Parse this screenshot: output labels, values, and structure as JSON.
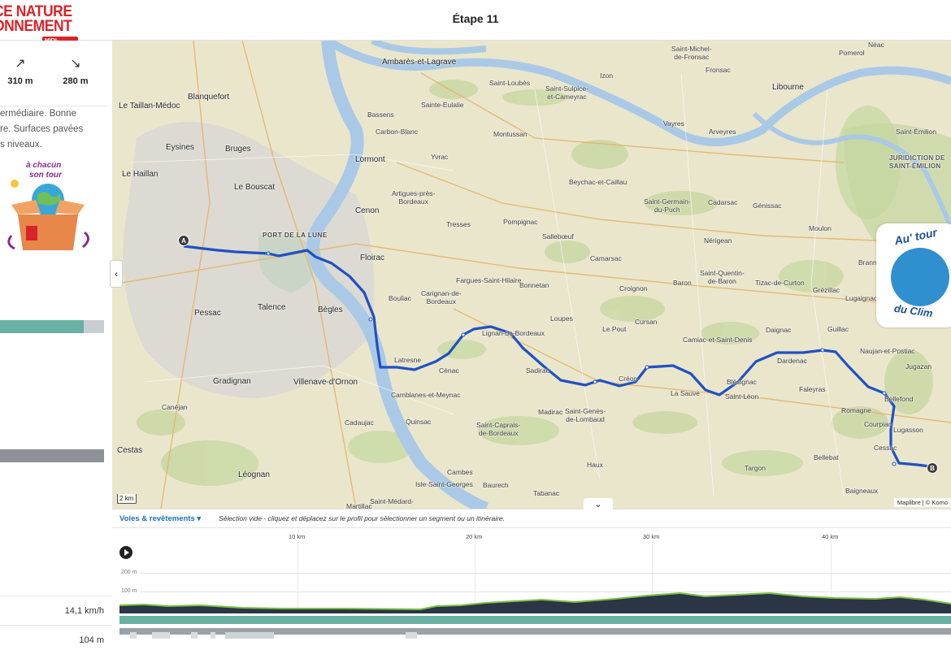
{
  "header": {
    "logo_line1": "CE NATURE",
    "logo_line2": "ONNEMENT",
    "logo_line3": "MIDI-PYRÉNÉES",
    "title": "Étape 11"
  },
  "sidebar": {
    "ascent": "310 m",
    "descent": "280 m",
    "description": [
      "ermédiaire. Bonne",
      "re. Surfaces pavées",
      "s niveaux."
    ],
    "badge_text_1": "à chacun",
    "badge_text_2": "son tour",
    "stat_speed": "14,1 km/h",
    "stat_other": "104 m"
  },
  "map": {
    "start_label": "A",
    "end_label": "B",
    "scale": "2 km",
    "attribution": "Maplibre | © Komo",
    "route_color": "#1f51c4",
    "water_color": "#a9c9e6",
    "climat_line1": "Au' tour",
    "climat_line2": "du Clim",
    "places": [
      {
        "name": "Saint-Michel-",
        "name2": "de-Fronsac"
      },
      {
        "name": "Ambarès-et-Lagrave"
      },
      {
        "name": "Saint-Loubès"
      },
      {
        "name": "Saint-Sulpice-",
        "name2": "et-Cameyrac"
      },
      {
        "name": "Izon"
      },
      {
        "name": "Fronsac"
      },
      {
        "name": "Libourne"
      },
      {
        "name": "Néac"
      },
      {
        "name": "Pomerol"
      },
      {
        "name": "Le Taillan-Médoc"
      },
      {
        "name": "Blanquefort"
      },
      {
        "name": "Sainte-Eulalie"
      },
      {
        "name": "Bassens"
      },
      {
        "name": "Carbon-Blanc"
      },
      {
        "name": "Vayres"
      },
      {
        "name": "Arveyres"
      },
      {
        "name": "Saint-Émilion"
      },
      {
        "name": "Eysines"
      },
      {
        "name": "Bruges"
      },
      {
        "name": "Lormont"
      },
      {
        "name": "Yvrac"
      },
      {
        "name": "Montussan"
      },
      {
        "name": "Le Haillan"
      },
      {
        "name": "Beychac-et-Caillau"
      },
      {
        "name": "Le Bouscat"
      },
      {
        "name": "Artigues-près-",
        "name2": "Bordeaux"
      },
      {
        "name": "Saint-Germain-",
        "name2": "du-Puch"
      },
      {
        "name": "Cadarsac"
      },
      {
        "name": "Génissac"
      },
      {
        "name": "Cenon"
      },
      {
        "name": "Tresses"
      },
      {
        "name": "Pompignac"
      },
      {
        "name": "Moulon"
      },
      {
        "name": "Sallebœuf"
      },
      {
        "name": "Nérigean"
      },
      {
        "name": "Camarsac"
      },
      {
        "name": "Floirac"
      },
      {
        "name": "Saint-Quentin-",
        "name2": "de-Baron"
      },
      {
        "name": "Fargues-Saint-Hilaire"
      },
      {
        "name": "Bonnetan"
      },
      {
        "name": "Baron"
      },
      {
        "name": "Tizac-de-Curton"
      },
      {
        "name": "Carignan-de-",
        "name2": "Bordeaux"
      },
      {
        "name": "Croignon"
      },
      {
        "name": "Grézillac"
      },
      {
        "name": "Pessac"
      },
      {
        "name": "Talence"
      },
      {
        "name": "Bègles"
      },
      {
        "name": "Bouliac"
      },
      {
        "name": "Lugaignac"
      },
      {
        "name": "Loupes"
      },
      {
        "name": "Cursan"
      },
      {
        "name": "Le Pout"
      },
      {
        "name": "Daignac"
      },
      {
        "name": "Lignan-de-Bordeaux"
      },
      {
        "name": "Guillac"
      },
      {
        "name": "Camiac-et-Saint-Denis"
      },
      {
        "name": "Latresne"
      },
      {
        "name": "Dardenac"
      },
      {
        "name": "Naujan-et-Postiac"
      },
      {
        "name": "Cénac"
      },
      {
        "name": "Sadirac"
      },
      {
        "name": "Créon"
      },
      {
        "name": "Blésignac"
      },
      {
        "name": "Jugazan"
      },
      {
        "name": "Gradignan"
      },
      {
        "name": "Villenave-d'Ornon"
      },
      {
        "name": "Faleyras"
      },
      {
        "name": "La Sauve"
      },
      {
        "name": "Saint-Léon"
      },
      {
        "name": "Camblanes-et-Meynac"
      },
      {
        "name": "Bellefond"
      },
      {
        "name": "Romagne"
      },
      {
        "name": "Canéjan"
      },
      {
        "name": "Madirac"
      },
      {
        "name": "Saint-Genès-",
        "name2": "de-Lombaud"
      },
      {
        "name": "Courpiac"
      },
      {
        "name": "Cadaujac"
      },
      {
        "name": "Quinsac"
      },
      {
        "name": "Saint-Caprais-",
        "name2": "de-Bordeaux"
      },
      {
        "name": "Lugasson"
      },
      {
        "name": "Cessac"
      },
      {
        "name": "Cestas"
      },
      {
        "name": "Bellebat"
      },
      {
        "name": "Haux"
      },
      {
        "name": "Targon"
      },
      {
        "name": "Léognan"
      },
      {
        "name": "Cambes"
      },
      {
        "name": "Isle-Saint-Georges"
      },
      {
        "name": "Baurech"
      },
      {
        "name": "Baigneaux"
      },
      {
        "name": "Tabanac"
      },
      {
        "name": "Martillac"
      },
      {
        "name": "Saint-Médard-"
      },
      {
        "name": "Brann"
      }
    ],
    "jurisdiction_line1": "JURIDICTION DE",
    "jurisdiction_line2": "SAINT-ÉMILION",
    "port_label": "PORT DE LA LUNE"
  },
  "profile": {
    "tab_label": "Voies & revêtements",
    "hint": "Sélection vide - cliquez et déplacez sur le profil pour sélectionner un segment ou un itinéraire.",
    "km_ticks": [
      "10 km",
      "20 km",
      "30 km",
      "40 km"
    ],
    "elev_labels": [
      "200 m",
      "100 m"
    ],
    "fill_color": "#2b3546",
    "line_color": "#79c143"
  }
}
